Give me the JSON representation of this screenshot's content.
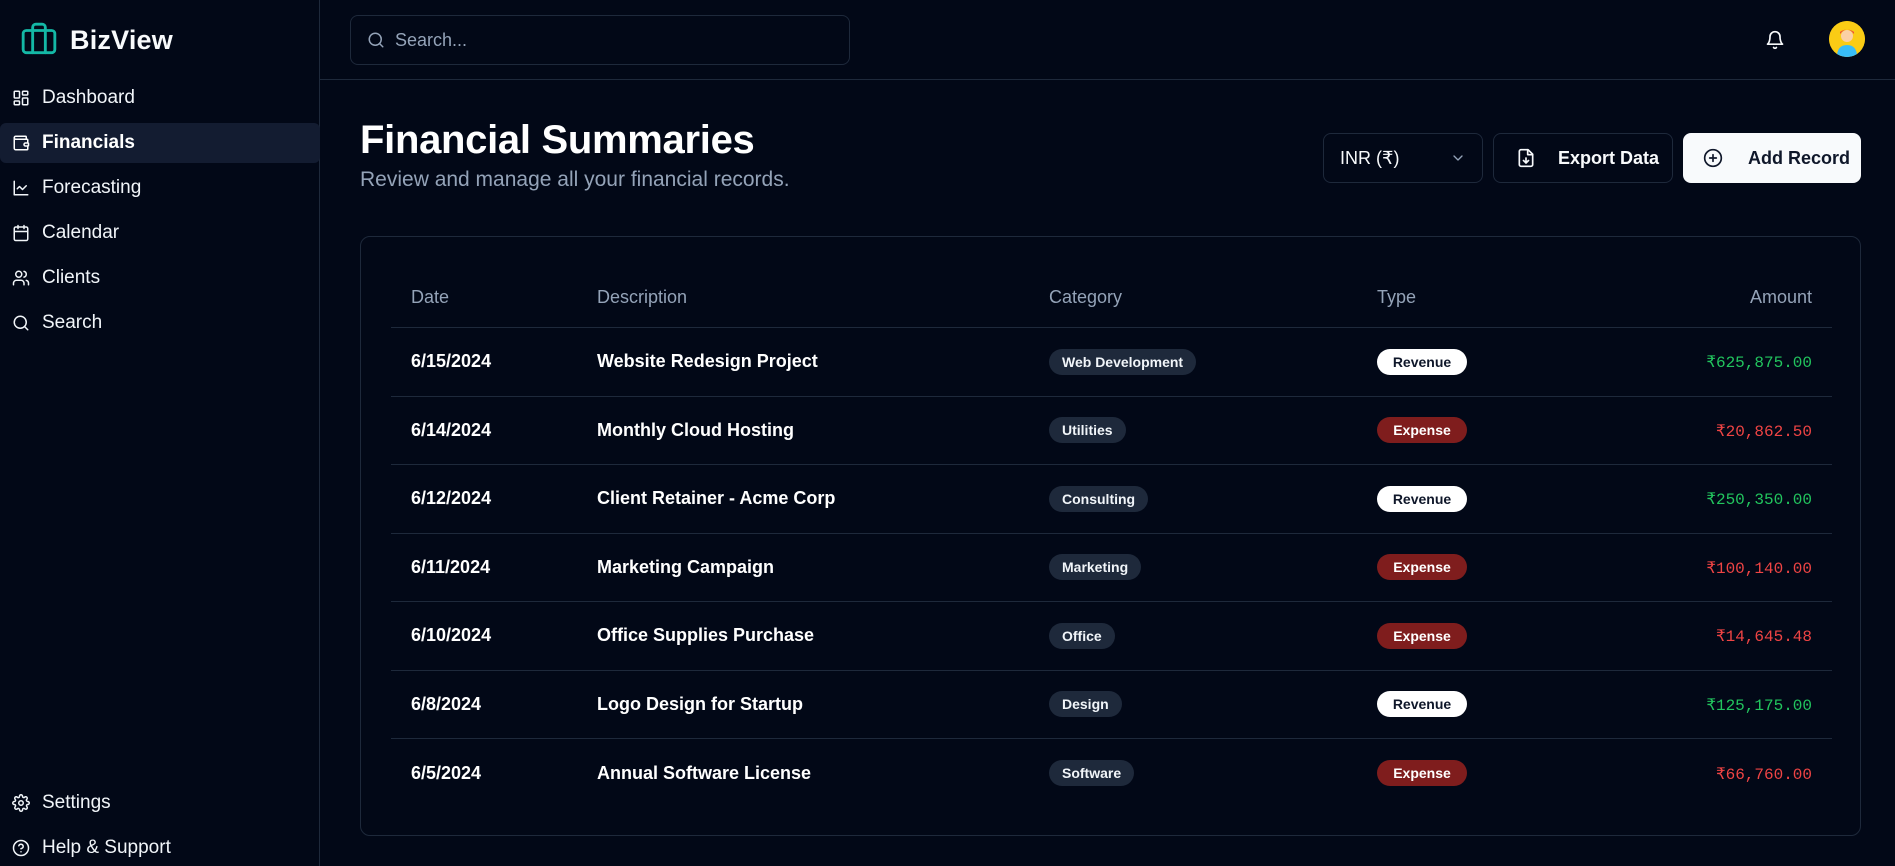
{
  "brand": {
    "name": "BizView",
    "accent": "#14b8a6"
  },
  "sidebar": {
    "items": [
      {
        "label": "Dashboard",
        "icon": "dashboard-icon",
        "active": false
      },
      {
        "label": "Financials",
        "icon": "wallet-icon",
        "active": true
      },
      {
        "label": "Forecasting",
        "icon": "line-chart-icon",
        "active": false
      },
      {
        "label": "Calendar",
        "icon": "calendar-icon",
        "active": false
      },
      {
        "label": "Clients",
        "icon": "users-icon",
        "active": false
      },
      {
        "label": "Search",
        "icon": "search-icon",
        "active": false
      }
    ],
    "bottom_items": [
      {
        "label": "Settings",
        "icon": "gear-icon"
      },
      {
        "label": "Help & Support",
        "icon": "help-circle-icon"
      }
    ]
  },
  "topbar": {
    "search_placeholder": "Search...",
    "notifications_icon": "bell-icon",
    "avatar_icon": "user-avatar"
  },
  "page": {
    "title": "Financial Summaries",
    "subtitle": "Review and manage all your financial records."
  },
  "toolbar": {
    "currency": "INR (₹)",
    "export_label": "Export Data",
    "add_label": "Add Record"
  },
  "table": {
    "columns": {
      "date": "Date",
      "description": "Description",
      "category": "Category",
      "type": "Type",
      "amount": "Amount"
    },
    "rows": [
      {
        "date": "6/15/2024",
        "description": "Website Redesign Project",
        "category": "Web Development",
        "type": "Revenue",
        "amount": "₹625,875.00"
      },
      {
        "date": "6/14/2024",
        "description": "Monthly Cloud Hosting",
        "category": "Utilities",
        "type": "Expense",
        "amount": "₹20,862.50"
      },
      {
        "date": "6/12/2024",
        "description": "Client Retainer - Acme Corp",
        "category": "Consulting",
        "type": "Revenue",
        "amount": "₹250,350.00"
      },
      {
        "date": "6/11/2024",
        "description": "Marketing Campaign",
        "category": "Marketing",
        "type": "Expense",
        "amount": "₹100,140.00"
      },
      {
        "date": "6/10/2024",
        "description": "Office Supplies Purchase",
        "category": "Office",
        "type": "Expense",
        "amount": "₹14,645.48"
      },
      {
        "date": "6/8/2024",
        "description": "Logo Design for Startup",
        "category": "Design",
        "type": "Revenue",
        "amount": "₹125,175.00"
      },
      {
        "date": "6/5/2024",
        "description": "Annual Software License",
        "category": "Software",
        "type": "Expense",
        "amount": "₹66,760.00"
      }
    ]
  },
  "colors": {
    "background": "#020817",
    "revenue_amount": "#22c55e",
    "expense_amount": "#ef4444",
    "expense_badge": "#7f1d1d",
    "revenue_badge": "#ffffff"
  }
}
